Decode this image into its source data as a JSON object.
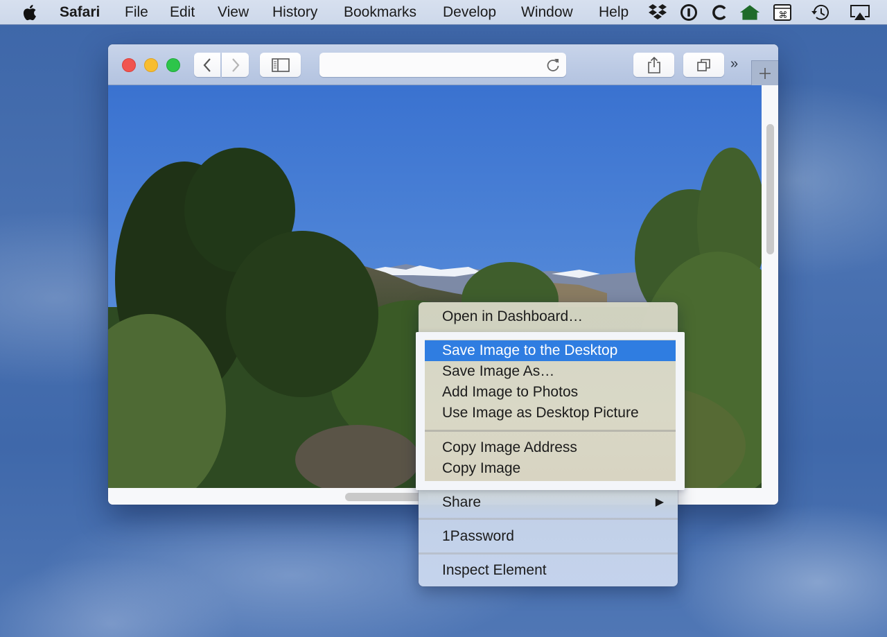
{
  "menubar": {
    "app_name": "Safari",
    "items": [
      "File",
      "Edit",
      "View",
      "History",
      "Bookmarks",
      "Develop",
      "Window",
      "Help"
    ],
    "tray_icons": [
      "dropbox-icon",
      "1password-icon",
      "c-app-icon",
      "home-icon",
      "command-key-icon",
      "time-machine-icon",
      "airplay-icon"
    ]
  },
  "window": {
    "toolbar": {
      "address_value": "",
      "overflow_label": "»",
      "new_tab_label": "+"
    }
  },
  "photo": {
    "description": "Mountain landscape with pine trees and snow-capped peaks under blue sky",
    "colors": {
      "sky_top": "#3a72d0",
      "sky_bottom": "#6a9de0"
    }
  },
  "context_menu": {
    "top_item": "Open in Dashboard…",
    "image_group": {
      "items": [
        {
          "label": "Save Image to the Desktop",
          "selected": true
        },
        {
          "label": "Save Image As…",
          "selected": false
        },
        {
          "label": "Add Image to Photos",
          "selected": false
        },
        {
          "label": "Use Image as Desktop Picture",
          "selected": false
        }
      ],
      "copy_items": [
        {
          "label": "Copy Image Address"
        },
        {
          "label": "Copy Image"
        }
      ]
    },
    "share_label": "Share",
    "share_arrow": "▶",
    "password_label": "1Password",
    "inspect_label": "Inspect Element",
    "highlight_color": "#2f7de1"
  }
}
